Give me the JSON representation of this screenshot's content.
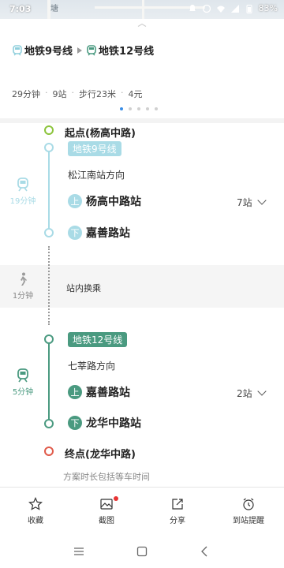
{
  "status_bar": {
    "time": "7:03",
    "battery": "83%"
  },
  "map": {
    "label": "塘"
  },
  "route": {
    "lines": [
      {
        "name": "地铁9号线"
      },
      {
        "name": "地铁12号线"
      }
    ],
    "summary": {
      "duration": "29分钟",
      "stops": "9站",
      "walk": "步行23米",
      "fare": "4元"
    },
    "pages": 5,
    "active_page": 0
  },
  "steps": {
    "start": {
      "label": "起点(杨高中路)"
    },
    "leg1": {
      "line": "地铁9号线",
      "direction": "松江南站方向",
      "board_badge": "上",
      "board_station": "杨高中路站",
      "stop_count": "7站",
      "alight_badge": "下",
      "alight_station": "嘉善路站",
      "duration": "19分钟",
      "color": "#a9dbe6"
    },
    "transfer": {
      "text": "站内换乘",
      "duration": "1分钟"
    },
    "leg2": {
      "line": "地铁12号线",
      "direction": "七莘路方向",
      "board_badge": "上",
      "board_station": "嘉善路站",
      "stop_count": "2站",
      "alight_badge": "下",
      "alight_station": "龙华中路站",
      "duration": "5分钟",
      "color": "#4a9a80"
    },
    "end": {
      "label": "终点(龙华中路)"
    },
    "note": "方案时长包括等车时间"
  },
  "actions": [
    {
      "label": "收藏",
      "icon": "star-icon"
    },
    {
      "label": "截图",
      "icon": "screenshot-icon"
    },
    {
      "label": "分享",
      "icon": "share-icon"
    },
    {
      "label": "到站提醒",
      "icon": "alarm-icon"
    }
  ],
  "colors": {
    "start": "#8cc43c",
    "end": "#e05a4a",
    "accent": "#3a8ee6"
  }
}
